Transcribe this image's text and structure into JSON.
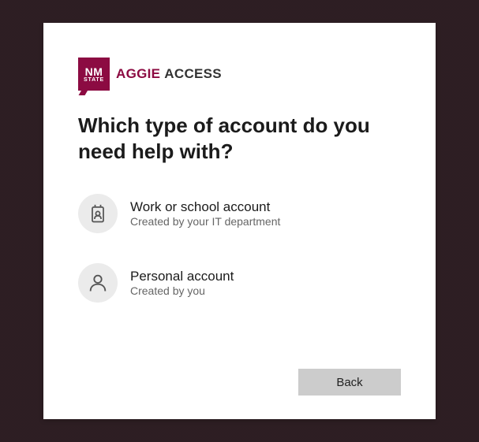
{
  "logo": {
    "top": "NM",
    "bottom": "STATE"
  },
  "brand": {
    "part1": "AGGIE",
    "part2": "ACCESS"
  },
  "heading": "Which type of account do you need help with?",
  "options": [
    {
      "title": "Work or school account",
      "subtitle": "Created by your IT department"
    },
    {
      "title": "Personal account",
      "subtitle": "Created by you"
    }
  ],
  "buttons": {
    "back": "Back"
  },
  "colors": {
    "brand": "#8c0b42"
  }
}
